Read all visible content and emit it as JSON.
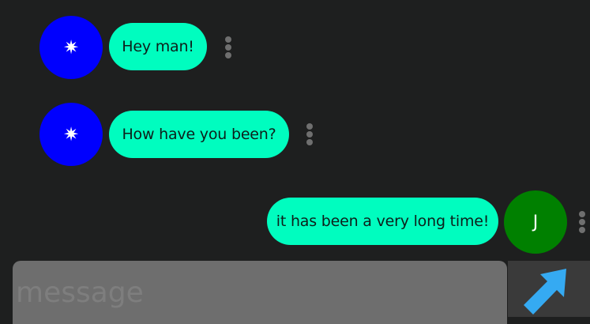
{
  "messages": [
    {
      "sender": "other",
      "avatar_glyph": "✷",
      "text": "Hey man!"
    },
    {
      "sender": "other",
      "avatar_glyph": "✷",
      "text": "How have you been?"
    },
    {
      "sender": "self",
      "avatar_initial": "J",
      "text": "it has been a very long time!"
    }
  ],
  "composer": {
    "placeholder": "message",
    "value": ""
  },
  "send_button": {
    "icon": "send-arrow-icon"
  },
  "colors": {
    "background": "#1e1f1f",
    "bubble": "#00fdbf",
    "avatar_other": "#0000fe",
    "avatar_self": "#008000",
    "composer_bg": "#6e6e6e",
    "send_bg": "#3a3a3a",
    "send_arrow": "#35aaf2"
  }
}
